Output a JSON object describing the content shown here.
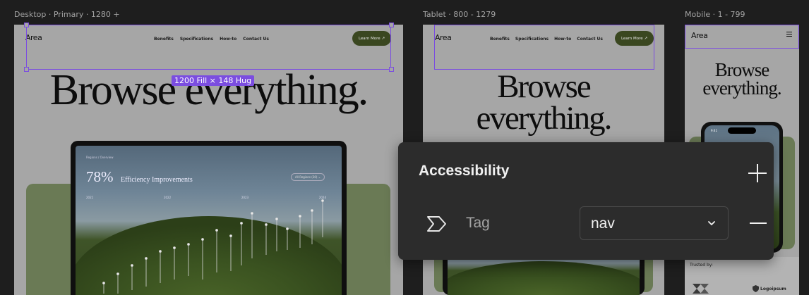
{
  "frames": {
    "desktop": {
      "label": "Desktop · Primary · 1280 +"
    },
    "tablet": {
      "label": "Tablet · 800 - 1279"
    },
    "mobile": {
      "label": "Mobile · 1 - 799"
    }
  },
  "site": {
    "logo": "Area",
    "nav": [
      "Benefits",
      "Specifications",
      "How-to",
      "Contact Us"
    ],
    "cta_label": "Learn More ↗",
    "hero_line1": "Browse",
    "hero_line2": "everything.",
    "hero_full": "Browse everything.",
    "trusted_by": "Trusted by:",
    "partner": "Logoipsum"
  },
  "dashboard": {
    "breadcrumb": "Regions / Overview",
    "stat_value": "78%",
    "stat_label": "Efficiency Improvements",
    "filter": "All Regions (30) ⌄",
    "years": [
      "2021",
      "2022",
      "2023",
      "2024"
    ]
  },
  "phone": {
    "time": "9:41"
  },
  "selection": {
    "size_badge": "1200 Fill × 148 Hug"
  },
  "accessibility_panel": {
    "title": "Accessibility",
    "tag_label": "Tag",
    "tag_value": "nav",
    "add_icon": "plus-icon",
    "remove_icon": "minus-icon",
    "tag_icon": "tag-icon",
    "dropdown_icon": "chevron-down-icon"
  },
  "colors": {
    "canvas": "#1e1e1e",
    "frame_bg": "#a6a6a6",
    "selection": "#7b4de0",
    "cta": "#3a4720",
    "panel_bg": "#2c2c2c"
  }
}
